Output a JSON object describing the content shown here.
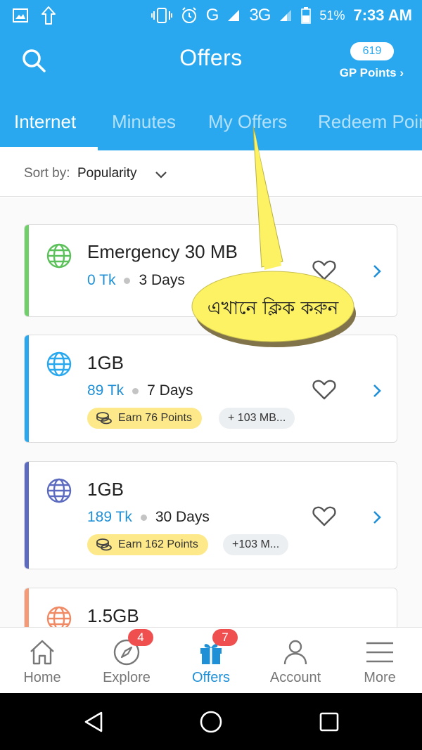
{
  "status_bar": {
    "network": "G",
    "network2": "3G",
    "network2_sup": "3G",
    "battery": "51%",
    "time": "7:33 AM"
  },
  "appbar": {
    "title": "Offers",
    "points": "619",
    "points_link": "GP Points ›",
    "search_icon": "search-icon"
  },
  "tabs": [
    {
      "label": "Internet",
      "active": true
    },
    {
      "label": "Minutes"
    },
    {
      "label": "My Offers"
    },
    {
      "label": "Redeem Points"
    }
  ],
  "sort": {
    "label": "Sort by:",
    "value": "Popularity"
  },
  "offers": [
    {
      "title": "Emergency 30 MB",
      "price": "0 Tk",
      "validity": "3 Days",
      "accent": "#6fd06a",
      "globe_color": "#5cc15a"
    },
    {
      "title": "1GB",
      "price": "89 Tk",
      "validity": "7 Days",
      "earn": "Earn 76 Points",
      "extra": "+ 103 MB...",
      "accent": "#29a8ef",
      "globe_color": "#29a8ef"
    },
    {
      "title": "1GB",
      "price": "189 Tk",
      "validity": "30 Days",
      "earn": "Earn 162 Points",
      "extra": "+103 M...",
      "accent": "#5c6bc0",
      "globe_color": "#5c6bc0"
    },
    {
      "title": "1.5GB",
      "accent": "#f59a74",
      "globe_color": "#f08a64"
    }
  ],
  "callout": {
    "text": "এখানে ক্লিক করুন",
    "fill": "#fdf263"
  },
  "bottom_nav": [
    {
      "label": "Home",
      "icon": "home-icon"
    },
    {
      "label": "Explore",
      "icon": "compass-icon",
      "badge": "4"
    },
    {
      "label": "Offers",
      "icon": "gift-icon",
      "badge": "7",
      "active": true
    },
    {
      "label": "Account",
      "icon": "person-icon"
    },
    {
      "label": "More",
      "icon": "menu-icon"
    }
  ],
  "colors": {
    "primary": "#29a8ef",
    "link": "#1f8fd6",
    "badge": "#ef4f4f"
  }
}
